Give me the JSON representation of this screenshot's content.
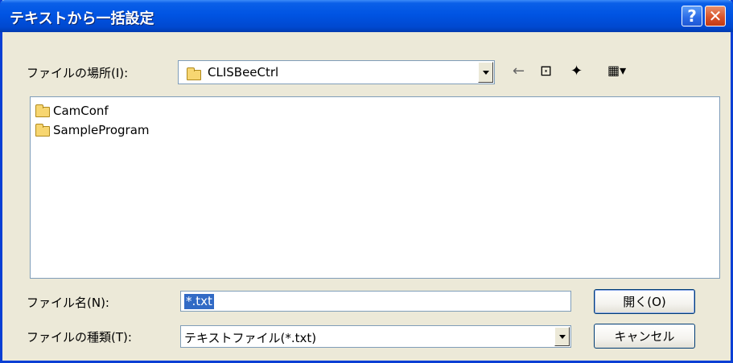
{
  "window": {
    "title": "テキストから一括設定",
    "help_glyph": "?",
    "close_glyph": "✕"
  },
  "look_in": {
    "label": "ファイルの場所(I):",
    "value": "CLISBeeCtrl"
  },
  "toolbar": {
    "back_glyph": "←",
    "up_glyph": "⊡",
    "newfolder_glyph": "✦",
    "view_glyph": "▦▾"
  },
  "files": [
    {
      "name": "CamConf",
      "icon": "folder-icon"
    },
    {
      "name": "SampleProgram",
      "icon": "folder-icon"
    }
  ],
  "file_name": {
    "label": "ファイル名(N):",
    "value": "*.txt"
  },
  "file_type": {
    "label": "ファイルの種類(T):",
    "value": "テキストファイル(*.txt)"
  },
  "buttons": {
    "open": "開く(O)",
    "cancel": "キャンセル"
  }
}
